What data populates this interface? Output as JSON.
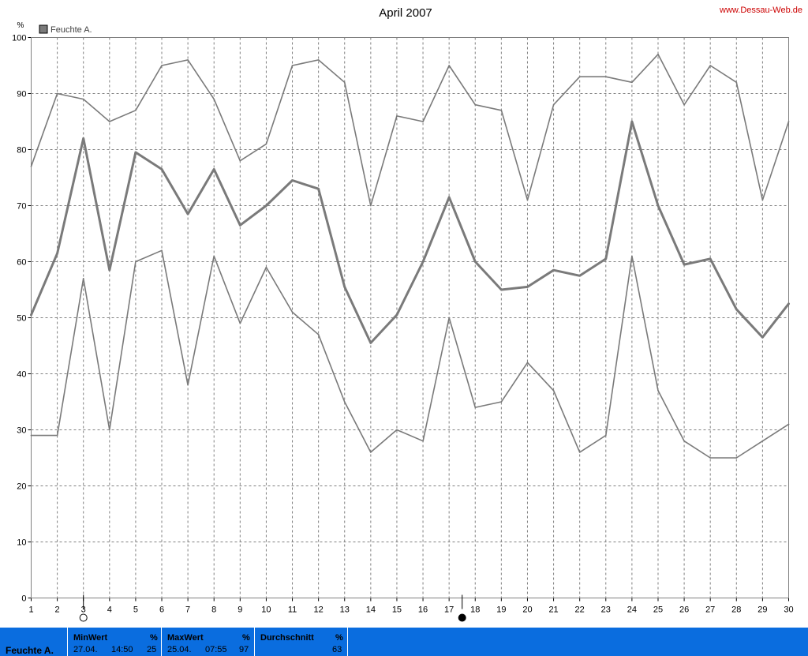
{
  "title": "April 2007",
  "site": "www.Dessau-Web.de",
  "unit": "%",
  "chart_data": {
    "type": "line",
    "title": "April 2007",
    "x": [
      1,
      2,
      3,
      4,
      5,
      6,
      7,
      8,
      9,
      10,
      11,
      12,
      13,
      14,
      15,
      16,
      17,
      18,
      19,
      20,
      21,
      22,
      23,
      24,
      25,
      26,
      27,
      28,
      29,
      30
    ],
    "ylim": [
      0,
      100
    ],
    "yticks": [
      0,
      10,
      20,
      30,
      40,
      50,
      60,
      70,
      80,
      90,
      100
    ],
    "ylabel": "%",
    "grid": true,
    "legend": {
      "placement": "top-left",
      "entries": [
        "Feuchte A."
      ]
    },
    "series": [
      {
        "role": "max",
        "color": "#7a7a7a",
        "values": [
          77,
          90,
          89,
          85,
          87,
          95,
          96,
          89,
          78,
          81,
          95,
          96,
          92,
          70,
          86,
          85,
          95,
          88,
          87,
          71,
          88,
          93,
          93,
          92,
          97,
          88,
          95,
          92,
          71,
          85
        ]
      },
      {
        "role": "mean",
        "name": "Feuchte A.",
        "color": "#7a7a7a",
        "values": [
          50.5,
          61.5,
          82,
          58.5,
          79.5,
          76.5,
          68.5,
          76.5,
          66.5,
          70,
          74.5,
          73,
          55.5,
          45.5,
          50.5,
          60,
          71.5,
          60,
          55,
          55.5,
          58.5,
          57.5,
          60.5,
          85,
          70,
          59.5,
          60.5,
          51.5,
          46.5,
          52.5
        ]
      },
      {
        "role": "min",
        "color": "#7a7a7a",
        "values": [
          29,
          29,
          57,
          30,
          60,
          62,
          38,
          61,
          49,
          59,
          51,
          47,
          35,
          26,
          30,
          28,
          50,
          34,
          35,
          42,
          37,
          26,
          29,
          61,
          37,
          28,
          25,
          25,
          28,
          31
        ]
      }
    ],
    "moon_markers": [
      {
        "day": 3,
        "phase": "full"
      },
      {
        "day": 17.5,
        "phase": "new"
      }
    ]
  },
  "footer": {
    "series_name": "Feuchte A.",
    "min": {
      "label": "MinWert",
      "unit": "%",
      "date": "27.04.",
      "time": "14:50",
      "value": "25"
    },
    "max": {
      "label": "MaxWert",
      "unit": "%",
      "date": "25.04.",
      "time": "07:55",
      "value": "97"
    },
    "avg": {
      "label": "Durchschnitt",
      "unit": "%",
      "value": "63"
    }
  }
}
